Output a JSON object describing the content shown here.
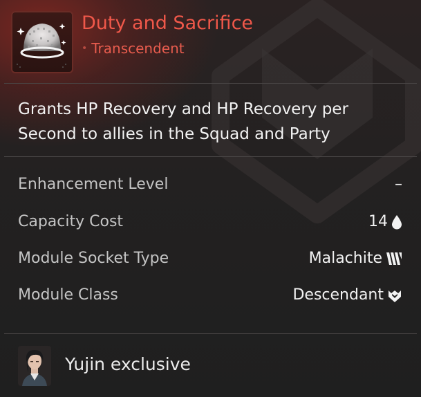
{
  "module": {
    "title": "Duty and Sacrifice",
    "rarity": "Transcendent",
    "icon": "sparkle-dome-icon",
    "description": "Grants HP Recovery and HP Recovery per Second to allies in the Squad and Party"
  },
  "stats": [
    {
      "label": "Enhancement Level",
      "value": "–",
      "icon": ""
    },
    {
      "label": "Capacity Cost",
      "value": "14",
      "icon": "droplet-icon"
    },
    {
      "label": "Module Socket Type",
      "value": "Malachite",
      "icon": "malachite-socket-icon"
    },
    {
      "label": "Module Class",
      "value": "Descendant",
      "icon": "descendant-class-icon"
    }
  ],
  "footer": {
    "text": "Yujin exclusive",
    "avatar": "yujin-portrait"
  },
  "colors": {
    "title": "#f0584a",
    "rarity": "#e85c4e",
    "background": "#1e1e1e",
    "label": "#c4c4c4",
    "value": "#f2f2f2"
  }
}
